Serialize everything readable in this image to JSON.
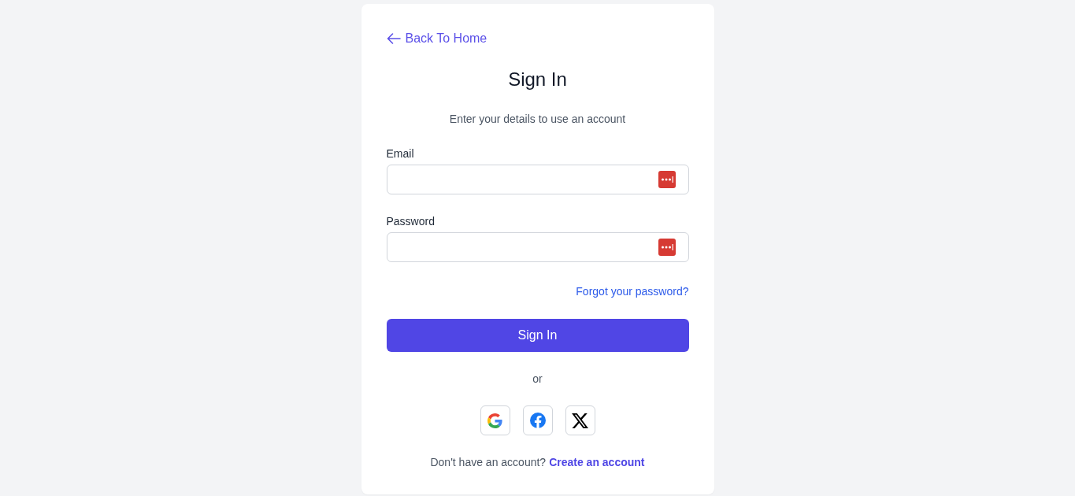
{
  "back_link": {
    "label": "Back To Home"
  },
  "title": "Sign In",
  "subtitle": "Enter your details to use an account",
  "fields": [
    {
      "label": "Email",
      "autofill_icon": true
    },
    {
      "label": "Password",
      "autofill_icon": true
    }
  ],
  "forgot_link": "Forgot your password?",
  "submit_button": "Sign In",
  "divider_text": "or",
  "social_buttons": [
    {
      "kind": "google"
    },
    {
      "kind": "facebook"
    },
    {
      "kind": "x"
    }
  ],
  "footer": {
    "text": "Don't have an account?",
    "link": "Create an account"
  }
}
